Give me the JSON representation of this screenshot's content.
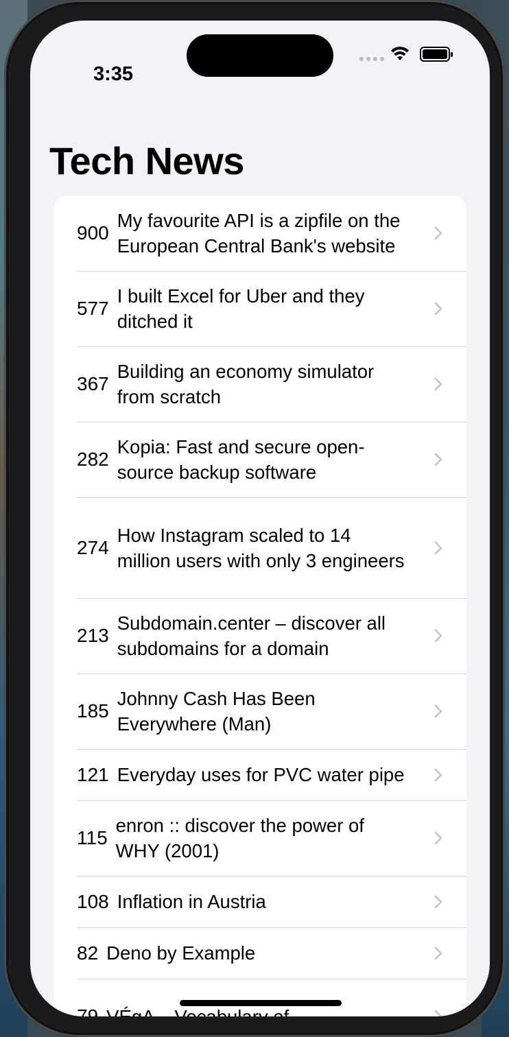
{
  "status_bar": {
    "time": "3:35"
  },
  "nav": {
    "title": "Tech News"
  },
  "items": [
    {
      "score": "900",
      "title": "My favourite API is a zipfile on the European Central Bank's website"
    },
    {
      "score": "577",
      "title": "I built Excel for Uber and they ditched it"
    },
    {
      "score": "367",
      "title": "Building an economy simulator from scratch"
    },
    {
      "score": "282",
      "title": "Kopia: Fast and secure open-source backup software"
    },
    {
      "score": "274",
      "title": "How Instagram scaled to 14 million users with only 3 engineers"
    },
    {
      "score": "213",
      "title": "Subdomain.center – discover all subdomains for a domain"
    },
    {
      "score": "185",
      "title": "Johnny Cash Has Been Everywhere (Man)"
    },
    {
      "score": "121",
      "title": "Everyday uses for PVC water pipe"
    },
    {
      "score": "115",
      "title": "enron :: discover the power of WHY (2001)"
    },
    {
      "score": "108",
      "title": "Inflation in Austria"
    },
    {
      "score": "82",
      "title": "Deno by Example"
    },
    {
      "score": "79",
      "title": "VÉgA – Vocabulary of"
    }
  ],
  "icons": {
    "row_accessory": "chevron-right-icon",
    "wifi": "wifi-icon",
    "battery": "battery-icon"
  }
}
